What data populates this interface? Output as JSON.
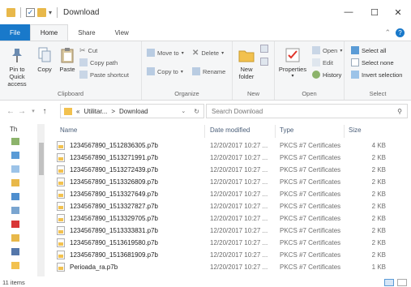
{
  "window": {
    "title": "Download",
    "minimize_glyph": "—",
    "maximize_glyph": "☐",
    "close_glyph": "✕"
  },
  "ribbon_tabs": [
    "File",
    "Home",
    "Share",
    "View"
  ],
  "ribbon": {
    "clipboard": {
      "pin_label": "Pin to Quick access",
      "copy_label": "Copy",
      "paste_label": "Paste",
      "cut_label": "Cut",
      "copy_path_label": "Copy path",
      "paste_shortcut_label": "Paste shortcut",
      "group_label": "Clipboard"
    },
    "organize": {
      "move_to_label": "Move to",
      "copy_to_label": "Copy to",
      "delete_label": "Delete",
      "rename_label": "Rename",
      "group_label": "Organize"
    },
    "new": {
      "new_folder_label": "New folder",
      "group_label": "New"
    },
    "open": {
      "properties_label": "Properties",
      "open_label": "Open",
      "edit_label": "Edit",
      "history_label": "History",
      "group_label": "Open"
    },
    "select": {
      "select_all_label": "Select all",
      "select_none_label": "Select none",
      "invert_label": "Invert selection",
      "group_label": "Select"
    }
  },
  "address": {
    "back": "←",
    "forward": "→",
    "up": "↑",
    "crumb_prefix": "«",
    "crumb_parent": "Utilitar...",
    "crumb_sep": ">",
    "crumb_current": "Download",
    "search_placeholder": "Search Download"
  },
  "columns": {
    "name": "Name",
    "date": "Date modified",
    "type": "Type",
    "size": "Size"
  },
  "files": [
    {
      "name": "1234567890_1512836305.p7b",
      "date": "12/20/2017 10:27 ...",
      "type": "PKCS #7 Certificates",
      "size": "4 KB"
    },
    {
      "name": "1234567890_1513271991.p7b",
      "date": "12/20/2017 10:27 ...",
      "type": "PKCS #7 Certificates",
      "size": "2 KB"
    },
    {
      "name": "1234567890_1513272439.p7b",
      "date": "12/20/2017 10:27 ...",
      "type": "PKCS #7 Certificates",
      "size": "2 KB"
    },
    {
      "name": "1234567890_1513326809.p7b",
      "date": "12/20/2017 10:27 ...",
      "type": "PKCS #7 Certificates",
      "size": "2 KB"
    },
    {
      "name": "1234567890_1513327649.p7b",
      "date": "12/20/2017 10:27 ...",
      "type": "PKCS #7 Certificates",
      "size": "2 KB"
    },
    {
      "name": "1234567890_1513327827.p7b",
      "date": "12/20/2017 10:27 ...",
      "type": "PKCS #7 Certificates",
      "size": "2 KB"
    },
    {
      "name": "1234567890_1513329705.p7b",
      "date": "12/20/2017 10:27 ...",
      "type": "PKCS #7 Certificates",
      "size": "2 KB"
    },
    {
      "name": "1234567890_1513333831.p7b",
      "date": "12/20/2017 10:27 ...",
      "type": "PKCS #7 Certificates",
      "size": "2 KB"
    },
    {
      "name": "1234567890_1513619580.p7b",
      "date": "12/20/2017 10:27 ...",
      "type": "PKCS #7 Certificates",
      "size": "2 KB"
    },
    {
      "name": "1234567890_1513681909.p7b",
      "date": "12/20/2017 10:27 ...",
      "type": "PKCS #7 Certificates",
      "size": "2 KB"
    },
    {
      "name": "Perioada_ra.p7b",
      "date": "12/20/2017 10:27 ...",
      "type": "PKCS #7 Certificates",
      "size": "1 KB"
    }
  ],
  "status": {
    "item_count": "11 items"
  },
  "nav_pane": {
    "first_item_label": "Th"
  },
  "colors": {
    "accent": "#1979ca",
    "folder": "#f2c14e"
  }
}
